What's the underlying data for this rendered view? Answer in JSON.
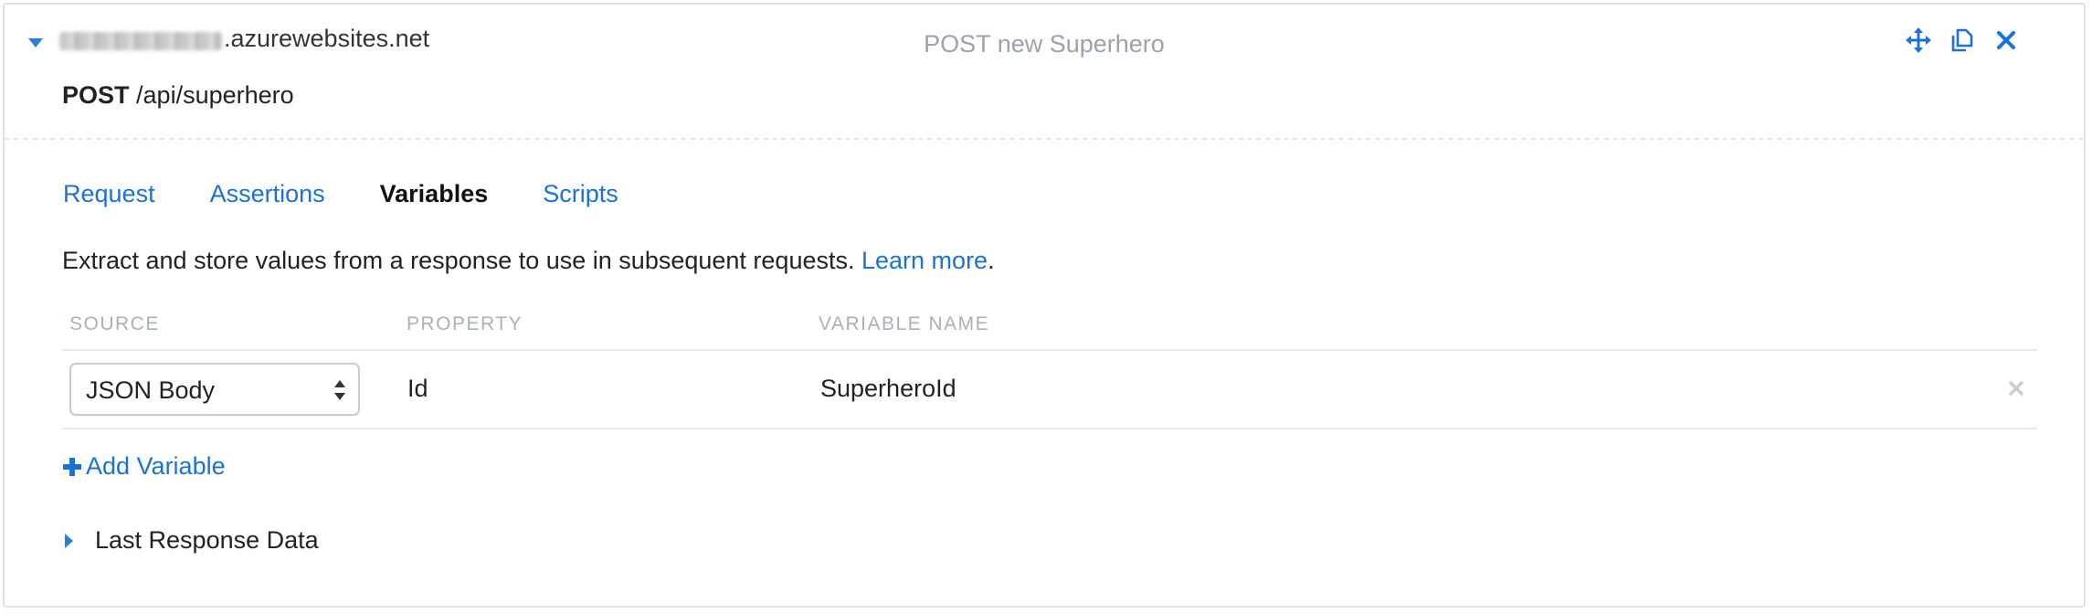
{
  "header": {
    "host_suffix": ".azurewebsites.net",
    "title": "POST new Superhero",
    "method": "POST",
    "path": "/api/superhero",
    "icons": [
      "move-icon",
      "copy-icon",
      "close-icon"
    ]
  },
  "tabs": [
    {
      "label": "Request",
      "active": false
    },
    {
      "label": "Assertions",
      "active": false
    },
    {
      "label": "Variables",
      "active": true
    },
    {
      "label": "Scripts",
      "active": false
    }
  ],
  "description": {
    "text": "Extract and store values from a response to use in subsequent requests.",
    "link": "Learn more",
    "suffix": "."
  },
  "table": {
    "headers": {
      "source": "SOURCE",
      "property": "PROPERTY",
      "variable_name": "VARIABLE NAME"
    },
    "rows": [
      {
        "source": "JSON Body",
        "property": "Id",
        "variable_name": "SuperheroId"
      }
    ]
  },
  "add_variable_label": "Add Variable",
  "last_response_label": "Last Response Data",
  "colors": {
    "accent": "#1a72d8",
    "muted": "#a8b1bb",
    "border": "#dfe3e8"
  }
}
